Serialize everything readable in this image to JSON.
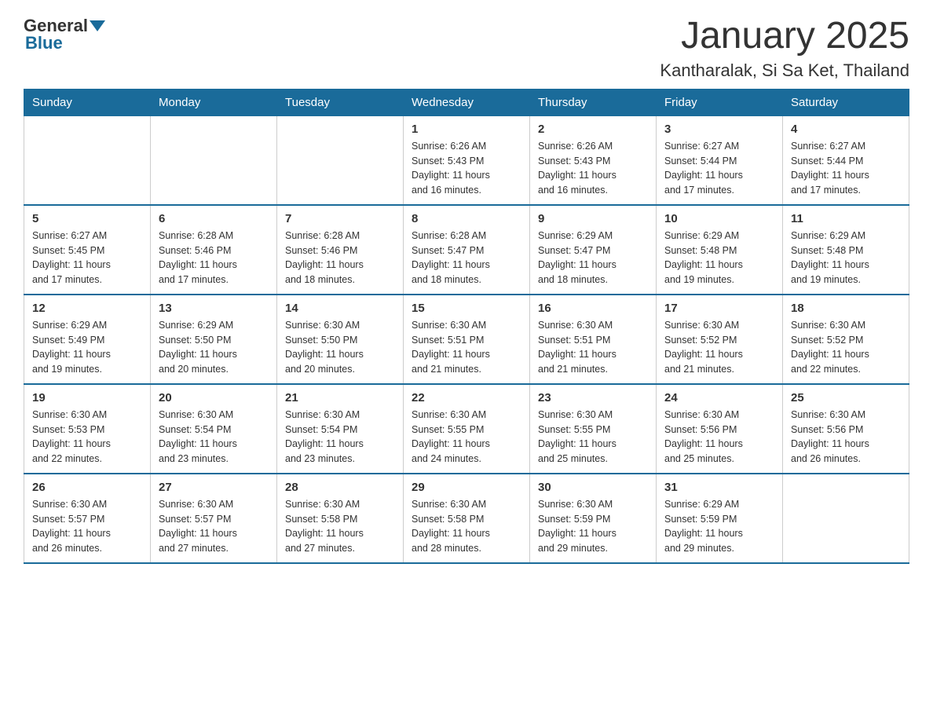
{
  "header": {
    "logo_general": "General",
    "logo_blue": "Blue",
    "title": "January 2025",
    "subtitle": "Kantharalak, Si Sa Ket, Thailand"
  },
  "calendar": {
    "days_of_week": [
      "Sunday",
      "Monday",
      "Tuesday",
      "Wednesday",
      "Thursday",
      "Friday",
      "Saturday"
    ],
    "weeks": [
      [
        {
          "day": "",
          "info": ""
        },
        {
          "day": "",
          "info": ""
        },
        {
          "day": "",
          "info": ""
        },
        {
          "day": "1",
          "info": "Sunrise: 6:26 AM\nSunset: 5:43 PM\nDaylight: 11 hours\nand 16 minutes."
        },
        {
          "day": "2",
          "info": "Sunrise: 6:26 AM\nSunset: 5:43 PM\nDaylight: 11 hours\nand 16 minutes."
        },
        {
          "day": "3",
          "info": "Sunrise: 6:27 AM\nSunset: 5:44 PM\nDaylight: 11 hours\nand 17 minutes."
        },
        {
          "day": "4",
          "info": "Sunrise: 6:27 AM\nSunset: 5:44 PM\nDaylight: 11 hours\nand 17 minutes."
        }
      ],
      [
        {
          "day": "5",
          "info": "Sunrise: 6:27 AM\nSunset: 5:45 PM\nDaylight: 11 hours\nand 17 minutes."
        },
        {
          "day": "6",
          "info": "Sunrise: 6:28 AM\nSunset: 5:46 PM\nDaylight: 11 hours\nand 17 minutes."
        },
        {
          "day": "7",
          "info": "Sunrise: 6:28 AM\nSunset: 5:46 PM\nDaylight: 11 hours\nand 18 minutes."
        },
        {
          "day": "8",
          "info": "Sunrise: 6:28 AM\nSunset: 5:47 PM\nDaylight: 11 hours\nand 18 minutes."
        },
        {
          "day": "9",
          "info": "Sunrise: 6:29 AM\nSunset: 5:47 PM\nDaylight: 11 hours\nand 18 minutes."
        },
        {
          "day": "10",
          "info": "Sunrise: 6:29 AM\nSunset: 5:48 PM\nDaylight: 11 hours\nand 19 minutes."
        },
        {
          "day": "11",
          "info": "Sunrise: 6:29 AM\nSunset: 5:48 PM\nDaylight: 11 hours\nand 19 minutes."
        }
      ],
      [
        {
          "day": "12",
          "info": "Sunrise: 6:29 AM\nSunset: 5:49 PM\nDaylight: 11 hours\nand 19 minutes."
        },
        {
          "day": "13",
          "info": "Sunrise: 6:29 AM\nSunset: 5:50 PM\nDaylight: 11 hours\nand 20 minutes."
        },
        {
          "day": "14",
          "info": "Sunrise: 6:30 AM\nSunset: 5:50 PM\nDaylight: 11 hours\nand 20 minutes."
        },
        {
          "day": "15",
          "info": "Sunrise: 6:30 AM\nSunset: 5:51 PM\nDaylight: 11 hours\nand 21 minutes."
        },
        {
          "day": "16",
          "info": "Sunrise: 6:30 AM\nSunset: 5:51 PM\nDaylight: 11 hours\nand 21 minutes."
        },
        {
          "day": "17",
          "info": "Sunrise: 6:30 AM\nSunset: 5:52 PM\nDaylight: 11 hours\nand 21 minutes."
        },
        {
          "day": "18",
          "info": "Sunrise: 6:30 AM\nSunset: 5:52 PM\nDaylight: 11 hours\nand 22 minutes."
        }
      ],
      [
        {
          "day": "19",
          "info": "Sunrise: 6:30 AM\nSunset: 5:53 PM\nDaylight: 11 hours\nand 22 minutes."
        },
        {
          "day": "20",
          "info": "Sunrise: 6:30 AM\nSunset: 5:54 PM\nDaylight: 11 hours\nand 23 minutes."
        },
        {
          "day": "21",
          "info": "Sunrise: 6:30 AM\nSunset: 5:54 PM\nDaylight: 11 hours\nand 23 minutes."
        },
        {
          "day": "22",
          "info": "Sunrise: 6:30 AM\nSunset: 5:55 PM\nDaylight: 11 hours\nand 24 minutes."
        },
        {
          "day": "23",
          "info": "Sunrise: 6:30 AM\nSunset: 5:55 PM\nDaylight: 11 hours\nand 25 minutes."
        },
        {
          "day": "24",
          "info": "Sunrise: 6:30 AM\nSunset: 5:56 PM\nDaylight: 11 hours\nand 25 minutes."
        },
        {
          "day": "25",
          "info": "Sunrise: 6:30 AM\nSunset: 5:56 PM\nDaylight: 11 hours\nand 26 minutes."
        }
      ],
      [
        {
          "day": "26",
          "info": "Sunrise: 6:30 AM\nSunset: 5:57 PM\nDaylight: 11 hours\nand 26 minutes."
        },
        {
          "day": "27",
          "info": "Sunrise: 6:30 AM\nSunset: 5:57 PM\nDaylight: 11 hours\nand 27 minutes."
        },
        {
          "day": "28",
          "info": "Sunrise: 6:30 AM\nSunset: 5:58 PM\nDaylight: 11 hours\nand 27 minutes."
        },
        {
          "day": "29",
          "info": "Sunrise: 6:30 AM\nSunset: 5:58 PM\nDaylight: 11 hours\nand 28 minutes."
        },
        {
          "day": "30",
          "info": "Sunrise: 6:30 AM\nSunset: 5:59 PM\nDaylight: 11 hours\nand 29 minutes."
        },
        {
          "day": "31",
          "info": "Sunrise: 6:29 AM\nSunset: 5:59 PM\nDaylight: 11 hours\nand 29 minutes."
        },
        {
          "day": "",
          "info": ""
        }
      ]
    ]
  }
}
